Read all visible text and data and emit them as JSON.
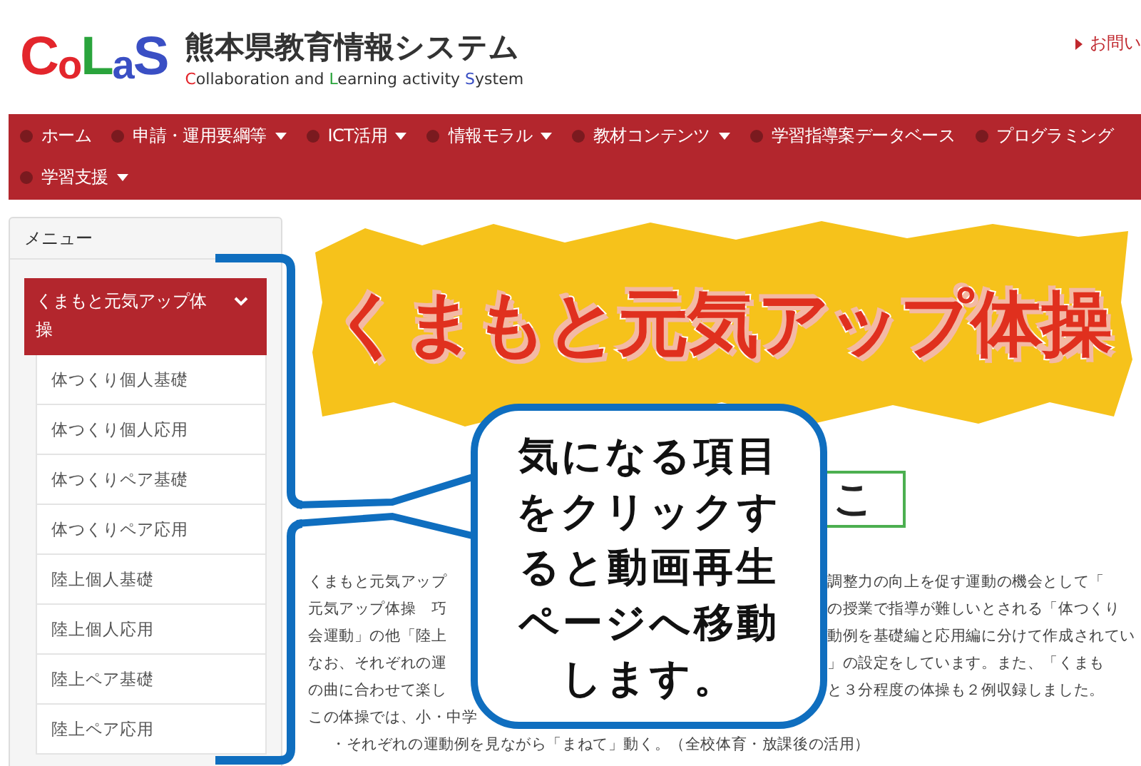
{
  "header": {
    "logo": [
      {
        "text": "C",
        "color": "#e3262c"
      },
      {
        "text": "o",
        "color": "#e3262c"
      },
      {
        "text": "L",
        "color": "#2aa43c"
      },
      {
        "text": "a",
        "color": "#3a4fc4"
      },
      {
        "text": "S",
        "color": "#3a4fc4"
      }
    ],
    "title": "熊本県教育情報システム",
    "subtitle": [
      {
        "text": "C",
        "color": "#e3262c"
      },
      {
        "text": "ollaboration and "
      },
      {
        "text": "L",
        "color": "#2aa43c"
      },
      {
        "text": "earning activity "
      },
      {
        "text": "S",
        "color": "#3a4fc4"
      },
      {
        "text": "ystem"
      }
    ],
    "contact_link": "お問い"
  },
  "nav": [
    {
      "label": "ホーム",
      "dropdown": false
    },
    {
      "label": "申請・運用要綱等",
      "dropdown": true
    },
    {
      "label": "ICT活用",
      "dropdown": true
    },
    {
      "label": "情報モラル",
      "dropdown": true
    },
    {
      "label": "教材コンテンツ",
      "dropdown": true
    },
    {
      "label": "学習指導案データベース",
      "dropdown": false
    },
    {
      "label": "プログラミング",
      "dropdown": false
    },
    {
      "label": "学習支援",
      "dropdown": true
    }
  ],
  "sidebar": {
    "title": "メニュー",
    "section": {
      "label": "くまもと元気アップ体操",
      "expanded": true
    },
    "items": [
      "体つくり個人基礎",
      "体つくり個人応用",
      "体つくりペア基礎",
      "体つくりペア応用",
      "陸上個人基礎",
      "陸上個人応用",
      "陸上ペア基礎",
      "陸上ペア応用"
    ]
  },
  "banner": {
    "title": "くまもと元気アップ体操"
  },
  "heading_fragment": "こ",
  "body_lines": [
    {
      "left": "くまもと元気アップ",
      "right": "調整力の向上を促す運動の機会として「"
    },
    {
      "left": "元気アップ体操　巧",
      "right": "の授業で指導が難しいとされる「体つくり"
    },
    {
      "left": "会運動」の他「陸上",
      "right": "動例を基礎編と応用編に分けて作成されてい"
    },
    {
      "left": "なお、それぞれの運",
      "right": "」の設定をしています。また、「くまも"
    },
    {
      "left": "の曲に合わせて楽し",
      "right": "と３分程度の体操も２例収録しました。"
    },
    {
      "left": "この体操では、小・中学"
    },
    {
      "left": "・それぞれの運動例を見ながら「まねて」動く。（全校体育・放課後の活用）",
      "indent": true
    }
  ],
  "callout": {
    "lines": [
      "気になる項目",
      "をクリックす",
      "ると動画再生",
      "ページへ移動",
      "します。"
    ]
  }
}
